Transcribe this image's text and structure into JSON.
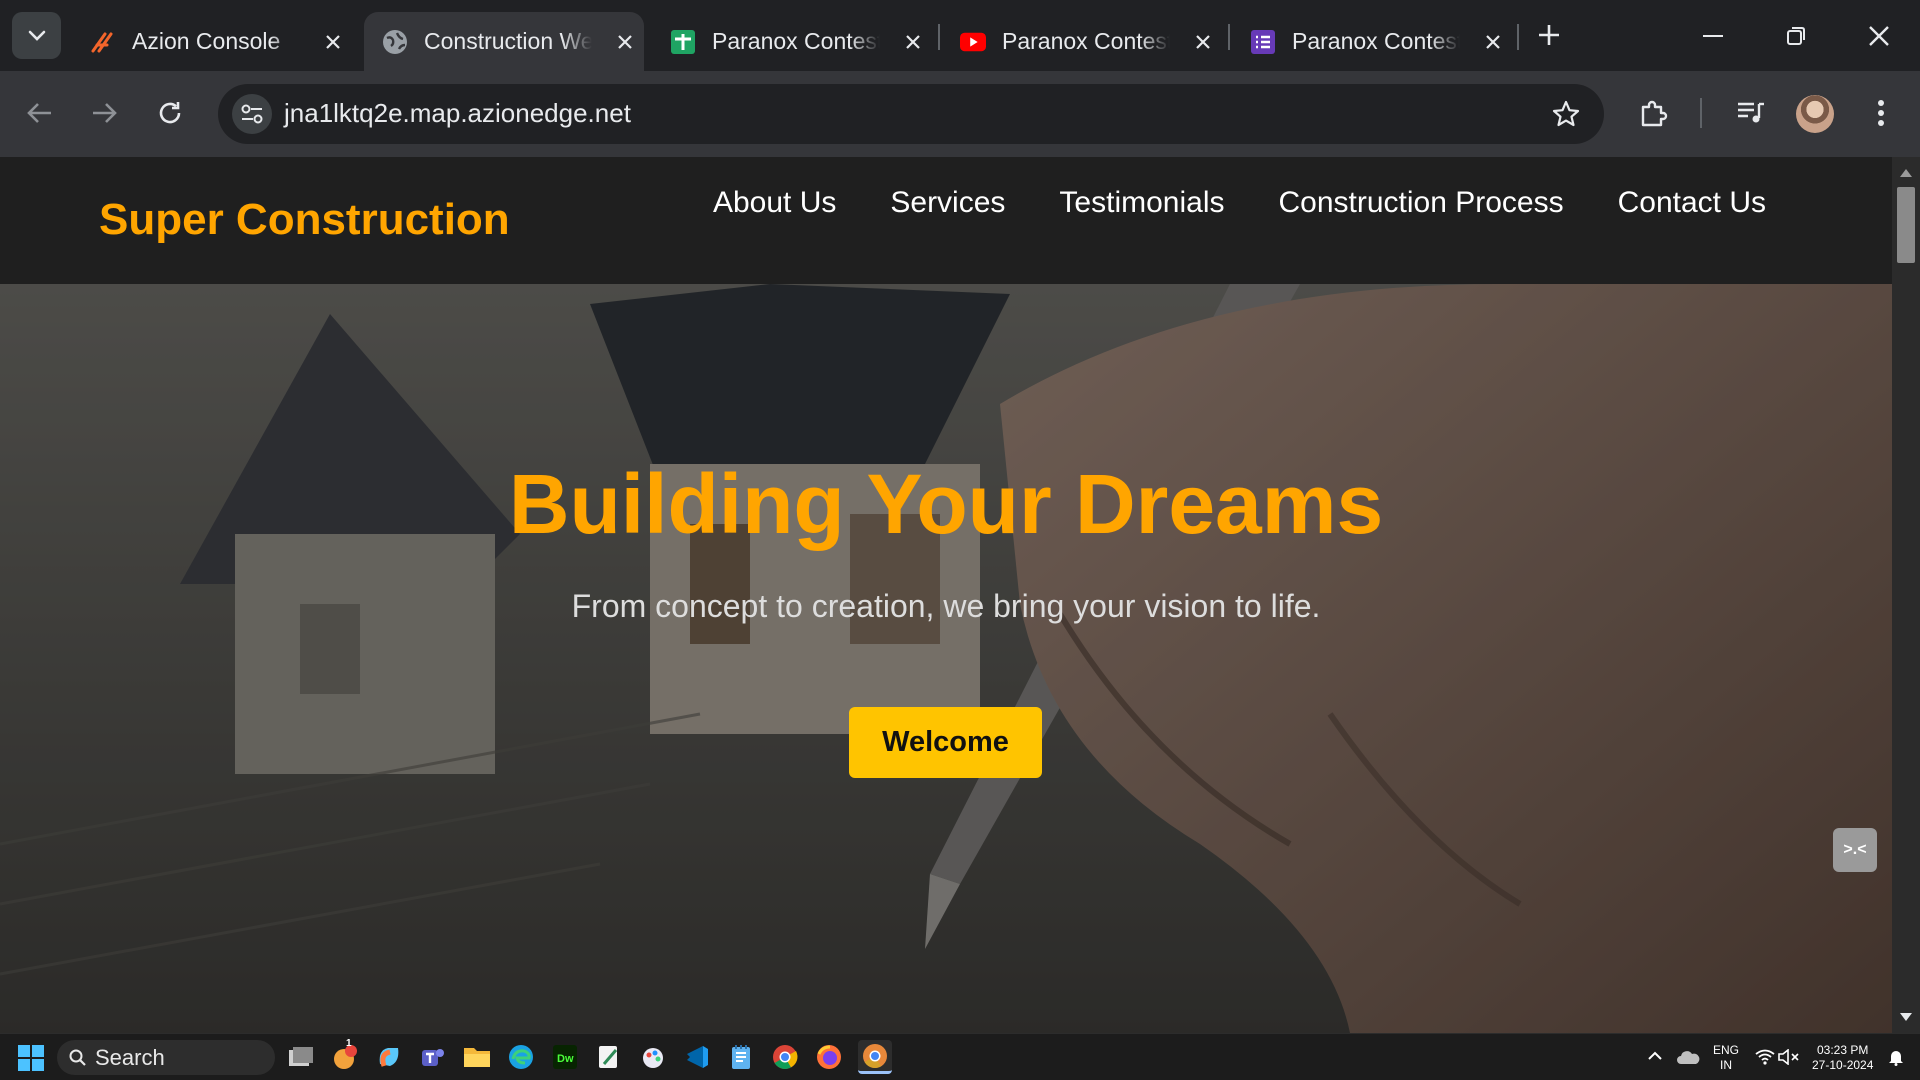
{
  "browser": {
    "tabs": [
      {
        "title": "Azion Console",
        "icon": "azion-logo-icon",
        "active": false
      },
      {
        "title": "Construction Website",
        "icon": "globe-icon",
        "active": true
      },
      {
        "title": "Paranox Contest",
        "icon": "sheets-plus-icon",
        "active": false
      },
      {
        "title": "Paranox Contest",
        "icon": "youtube-icon",
        "active": false
      },
      {
        "title": "Paranox Contest",
        "icon": "forms-list-icon",
        "active": false
      }
    ],
    "address_bar": {
      "url": "jna1lktq2e.map.azionedge.net"
    }
  },
  "site": {
    "brand": "Super Construction",
    "nav": [
      "About Us",
      "Services",
      "Testimonials",
      "Construction Process",
      "Contact Us"
    ],
    "hero": {
      "title": "Building Your Dreams",
      "subtitle": "From concept to creation, we bring your vision to life.",
      "button": "Welcome"
    },
    "float_widget": ">.<"
  },
  "taskbar": {
    "search_label": "Search",
    "apps": [
      "task-view-icon",
      "chat-widget-icon",
      "copilot-icon",
      "teams-icon",
      "file-explorer-icon",
      "edge-icon",
      "dreamweaver-icon",
      "notepad-edit-icon",
      "paint-icon",
      "vscode-icon",
      "notepad-icon",
      "chrome-icon",
      "firefox-icon",
      "chrome-canary-icon"
    ],
    "apps_badge": "1",
    "tray": {
      "lang_line1": "ENG",
      "lang_line2": "IN",
      "time": "03:23 PM",
      "date": "27-10-2024"
    }
  },
  "colors": {
    "brand": "#ffa500",
    "button": "#ffc400",
    "header_bg": "#1f1f1f",
    "browser_bg": "#202124"
  }
}
